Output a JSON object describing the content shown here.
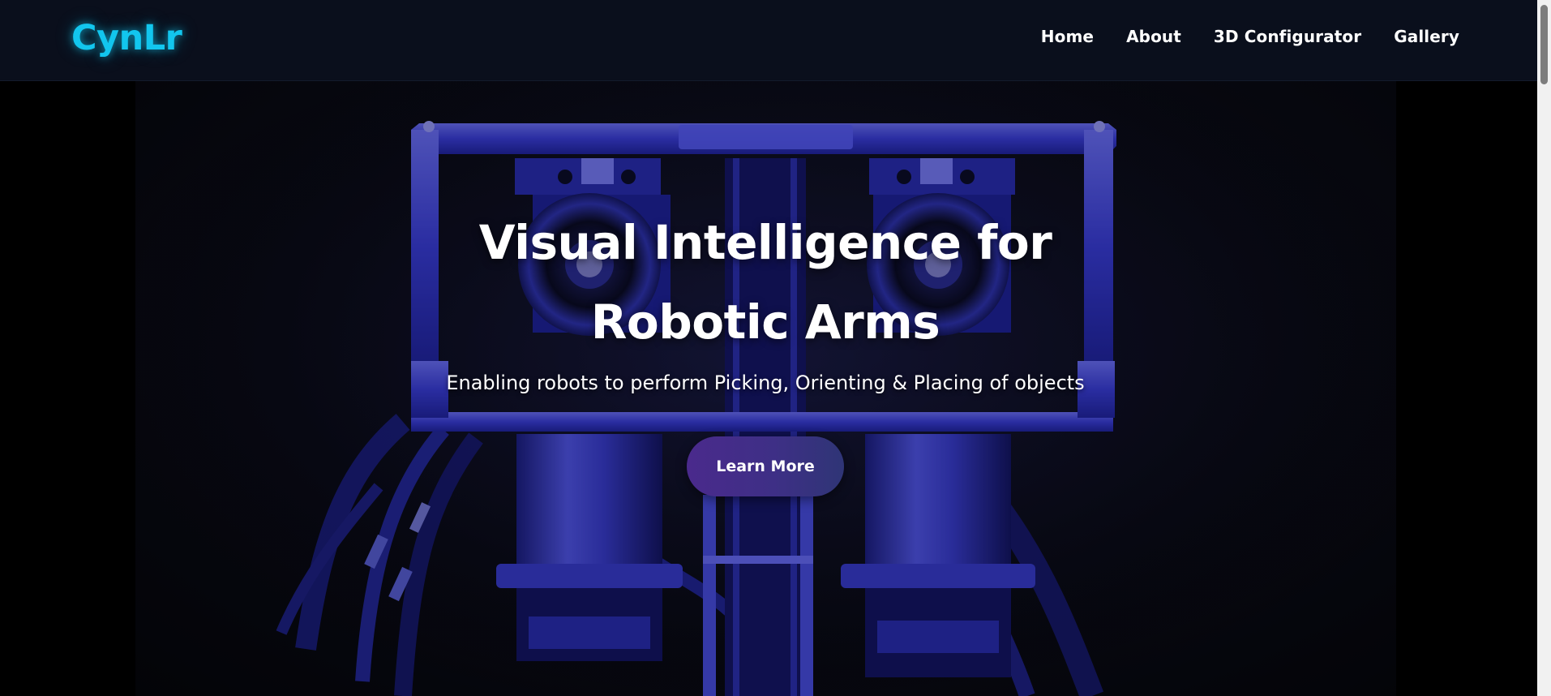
{
  "nav": {
    "logo": "CynLr",
    "links": [
      {
        "label": "Home"
      },
      {
        "label": "About"
      },
      {
        "label": "3D Configurator"
      },
      {
        "label": "Gallery"
      }
    ]
  },
  "hero": {
    "image_icon": "stereo-camera-robot-head-icon",
    "title": "Visual Intelligence for Robotic Arms",
    "subtitle": "Enabling robots to perform Picking, Orienting & Placing of objects",
    "button_label": "Learn More"
  },
  "colors": {
    "accent_logo": "#12c6ee",
    "nav_background": "#0a0f1c",
    "robot_tint": "#3a3ff0",
    "button_gradient_start": "#4a2a8c",
    "button_gradient_end": "#2f3576"
  }
}
